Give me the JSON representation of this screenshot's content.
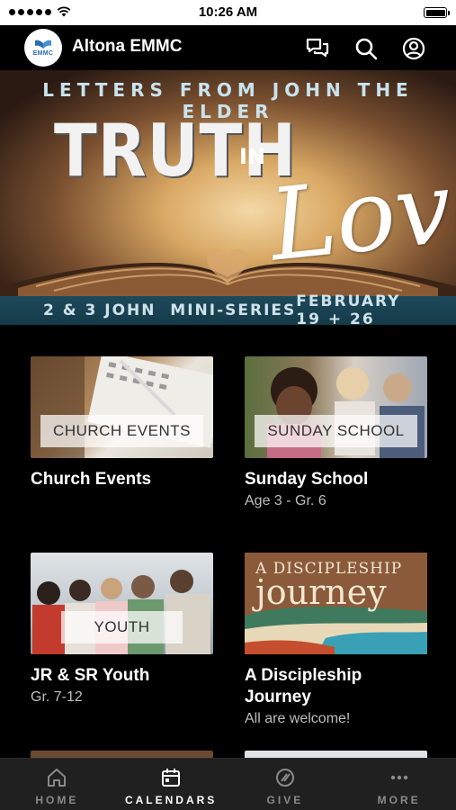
{
  "status_bar": {
    "time": "10:26 AM"
  },
  "header": {
    "app_title": "Altona EMMC",
    "logo_text": "EMMC"
  },
  "hero": {
    "top_line": "LETTERS FROM JOHN THE ELDER",
    "title_main": "TRUTH",
    "title_in": "IN",
    "title_script": "Love",
    "bottom_left": "2 & 3 JOHN  MINI-SERIES",
    "bottom_right": "FEBRUARY 19 + 26",
    "pager_count": 4,
    "pager_active": 0
  },
  "cards": [
    {
      "image_label": "CHURCH EVENTS",
      "title": "Church Events",
      "subtitle": ""
    },
    {
      "image_label": "SUNDAY SCHOOL",
      "title": "Sunday School",
      "subtitle": "Age 3 - Gr. 6"
    },
    {
      "image_label": "YOUTH",
      "title": "JR & SR Youth",
      "subtitle": "Gr. 7-12"
    },
    {
      "image_label": "",
      "image_heading_1": "A DISCIPLESHIP",
      "image_heading_2": "journey",
      "title": "A Discipleship Journey",
      "subtitle": "All are welcome!"
    }
  ],
  "tabs": [
    {
      "label": "HOME",
      "icon": "home-icon"
    },
    {
      "label": "CALENDARS",
      "icon": "calendar-icon"
    },
    {
      "label": "GIVE",
      "icon": "give-icon"
    },
    {
      "label": "MORE",
      "icon": "more-icon"
    }
  ],
  "colors": {
    "background": "#000000",
    "tab_bar": "#202020",
    "hero_band": "#1d4a5b",
    "active_tab": "#ffffff",
    "inactive_tab": "#8a8a8a"
  }
}
